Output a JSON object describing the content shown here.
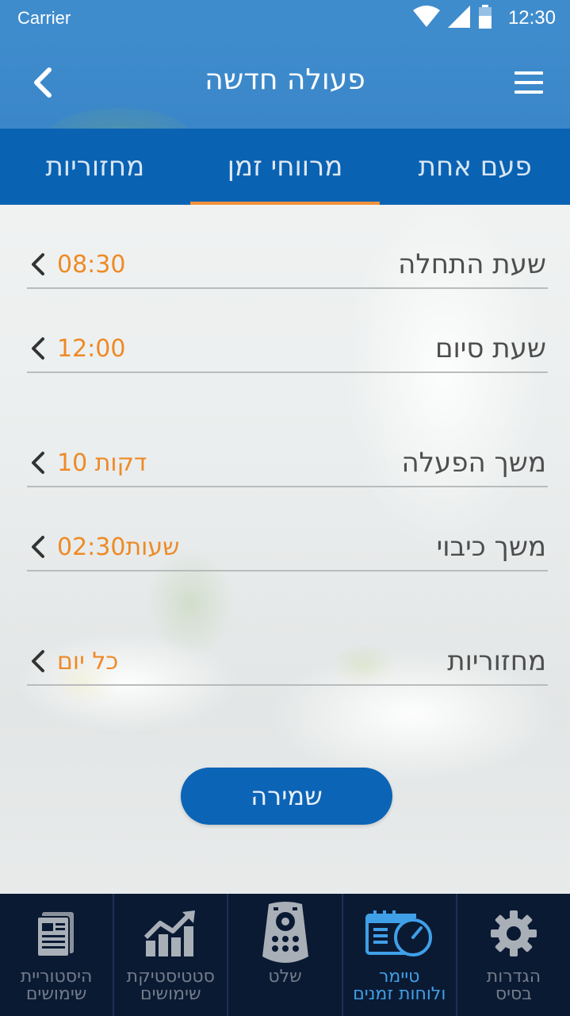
{
  "status_bar": {
    "carrier": "Carrier",
    "time": "12:30",
    "icons": [
      "wifi-icon",
      "signal-icon",
      "battery-icon"
    ]
  },
  "header": {
    "title": "פעולה חדשה",
    "back_icon": "chevron-left-icon",
    "menu_icon": "hamburger-menu-icon"
  },
  "tabs": [
    {
      "label": "פעם אחת",
      "active": false
    },
    {
      "label": "מרווחי זמן",
      "active": true
    },
    {
      "label": "מחזוריות",
      "active": false
    }
  ],
  "form": {
    "rows": [
      {
        "label": "שעת התחלה",
        "value": "08:30"
      },
      {
        "label": "שעת סיום",
        "value": "12:00"
      },
      {
        "label": "משך הפעלה",
        "value": "10 דקות"
      },
      {
        "label": "משך כיבוי",
        "value": "02:30שעות"
      },
      {
        "label": "מחזוריות",
        "value": "כל יום"
      }
    ]
  },
  "save_button": {
    "label": "שמירה"
  },
  "bottom_nav": [
    {
      "label": "הגדרות\nבסיס",
      "icon": "gear-icon",
      "active": false
    },
    {
      "label": "טיימר\nולוחות זמנים",
      "icon": "calendar-timer-icon",
      "active": true
    },
    {
      "label": "שלט",
      "icon": "remote-control-icon",
      "active": false
    },
    {
      "label": "סטטיסטיקת\nשימושים",
      "icon": "chart-growth-icon",
      "active": false
    },
    {
      "label": "היסטוריית\nשימושים",
      "icon": "document-history-icon",
      "active": false
    }
  ],
  "colors": {
    "header_blue": "#3f8ccd",
    "tab_blue": "#0a62b3",
    "accent_orange": "#ee8a26",
    "nav_dark": "#0b1a33",
    "nav_active": "#3fa0e8"
  }
}
